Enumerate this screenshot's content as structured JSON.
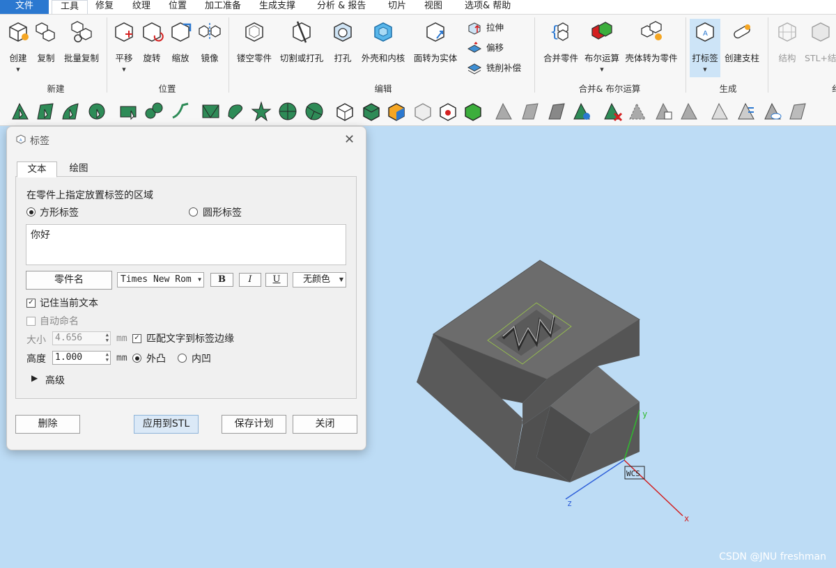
{
  "menu": {
    "items": [
      "文件",
      "工具",
      "修复",
      "纹理",
      "位置",
      "加工准备",
      "生成支撑",
      "分析 & 报告",
      "切片",
      "视图",
      "选项& 帮助"
    ]
  },
  "ribbon": {
    "groups": {
      "new": {
        "label": "新建",
        "buttons": [
          "创建",
          "复制",
          "批量复制"
        ]
      },
      "position": {
        "label": "位置",
        "buttons": [
          "平移",
          "旋转",
          "缩放",
          "镜像"
        ]
      },
      "edit": {
        "label": "编辑",
        "buttons": [
          "镂空零件",
          "切割或打孔",
          "打孔",
          "外壳和内核",
          "面转为实体"
        ],
        "small": [
          "拉伸",
          "偏移",
          "铣削补偿"
        ]
      },
      "merge": {
        "label": "合并& 布尔运算",
        "buttons": [
          "合并零件",
          "布尔运算",
          "壳体转为零件"
        ]
      },
      "generate": {
        "label": "生成",
        "buttons": [
          "打标签",
          "创建支柱"
        ]
      },
      "extra": {
        "label": "纟",
        "buttons": [
          "结构",
          "STL+结"
        ]
      }
    }
  },
  "dialog": {
    "title": "标签",
    "tabs": [
      "文本",
      "绘图"
    ],
    "region_hint": "在零件上指定放置标签的区域",
    "shape_square": "方形标签",
    "shape_round": "圆形标签",
    "text_value": "你好",
    "part_name_button": "零件名",
    "font_name": "Times New Rom",
    "bold": "B",
    "italic": "I",
    "underline": "U",
    "color": "无颜色",
    "remember_text": "记住当前文本",
    "auto_name": "自动命名",
    "size_label": "大小",
    "size_value": "4.656",
    "size_unit": "mm",
    "fit_text": "匹配文字到标签边缘",
    "height_label": "高度",
    "height_value": "1.000",
    "height_unit": "mm",
    "emboss": "外凸",
    "engrave": "内凹",
    "advanced": "高级",
    "buttons": {
      "delete": "删除",
      "apply": "应用到STL",
      "save": "保存计划",
      "close": "关闭"
    }
  },
  "viewport": {
    "axis_x": "x",
    "axis_y": "y",
    "axis_z": "z",
    "wcs": "WCS",
    "watermark": "CSDN @JNU freshman"
  },
  "colors": {
    "accent": "#2b78d0",
    "viewport_bg": "#bddcf5",
    "part": "#6f6f6f",
    "axis_x": "#d31b1b",
    "axis_y": "#2fbb2f",
    "axis_z": "#2e5fd9"
  }
}
